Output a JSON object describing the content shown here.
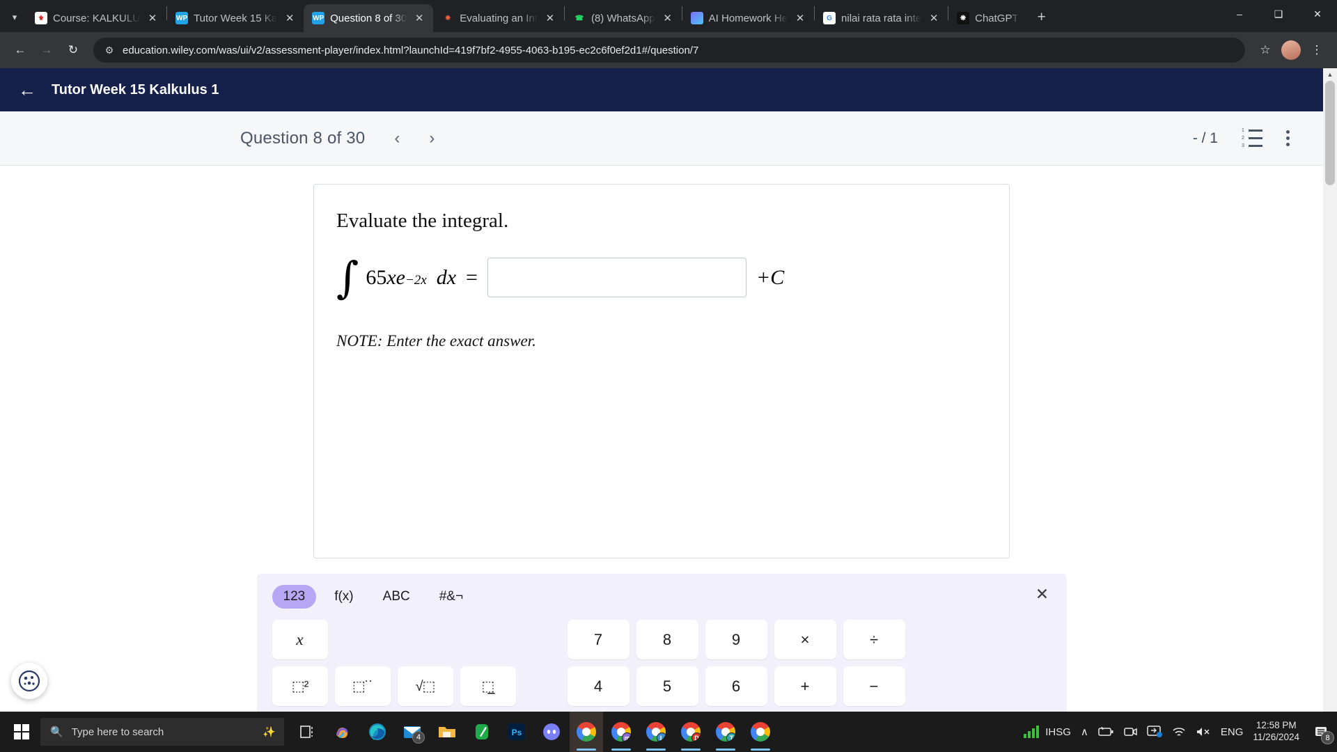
{
  "browser": {
    "tabs": [
      {
        "title": "Course: KALKULU",
        "favicon": "wiley-icon",
        "active": false
      },
      {
        "title": "Tutor Week 15 Ka",
        "favicon": "wileyplus-icon",
        "active": false
      },
      {
        "title": "Question 8 of 30",
        "favicon": "wileyplus-icon",
        "active": true
      },
      {
        "title": "Evaluating an Int",
        "favicon": "symbolab-icon",
        "active": false
      },
      {
        "title": "(8) WhatsApp",
        "favicon": "whatsapp-icon",
        "active": false
      },
      {
        "title": "AI Homework He",
        "favicon": "ai-homework-icon",
        "active": false
      },
      {
        "title": "nilai rata rata inte",
        "favicon": "google-icon",
        "active": false
      },
      {
        "title": "ChatGPT",
        "favicon": "chatgpt-icon",
        "active": false
      }
    ],
    "new_tab_label": "+",
    "window_controls": {
      "minimize": "–",
      "maximize": "❑",
      "close": "✕"
    },
    "toolbar": {
      "back": "←",
      "forward": "→",
      "reload": "↻",
      "site_info_icon": "tune-icon",
      "url": "education.wiley.com/was/ui/v2/assessment-player/index.html?launchId=419f7bf2-4955-4063-b195-ec2c6f0ef2d1#/question/7",
      "bookmark": "☆",
      "menu": "⋮"
    }
  },
  "app": {
    "back_arrow": "←",
    "title": "Tutor Week 15 Kalkulus 1",
    "header_color": "#16214b"
  },
  "question_bar": {
    "label": "Question 8 of 30",
    "prev": "‹",
    "next": "›",
    "score": "- / 1",
    "list_numbers": [
      "1",
      "2",
      "3"
    ],
    "more_menu": "kebab-icon"
  },
  "question": {
    "prompt": "Evaluate the integral.",
    "integral_symbol": "∫",
    "integrand_coefficient": "65",
    "integrand_var": "xe",
    "exponent": "−2x",
    "differential": "dx",
    "equals": "=",
    "answer_value": "",
    "answer_placeholder": "",
    "plus_c": "+C",
    "note": "NOTE: Enter the exact answer."
  },
  "math_keyboard": {
    "tabs": [
      {
        "label": "123",
        "active": true
      },
      {
        "label": "f(x)",
        "active": false
      },
      {
        "label": "ABC",
        "active": false
      },
      {
        "label": "#&¬",
        "active": false
      }
    ],
    "close": "✕",
    "accent_color": "#b7a6f3",
    "left_keys": [
      {
        "label": "x",
        "name": "key-variable-x",
        "style": "var"
      },
      {
        "label": "",
        "name": "key-blank-1",
        "style": "blank"
      },
      {
        "label": "",
        "name": "key-blank-2",
        "style": "blank"
      },
      {
        "label": "",
        "name": "key-blank-3",
        "style": "blank"
      },
      {
        "label": "⬚²",
        "name": "key-square",
        "style": "glyph"
      },
      {
        "label": "⬚˙˙",
        "name": "key-power",
        "style": "glyph"
      },
      {
        "label": "√⬚",
        "name": "key-sqrt",
        "style": "glyph"
      },
      {
        "label": "⬚̲",
        "name": "key-fraction",
        "style": "glyph"
      }
    ],
    "right_keys": [
      {
        "label": "7",
        "name": "key-7"
      },
      {
        "label": "8",
        "name": "key-8"
      },
      {
        "label": "9",
        "name": "key-9"
      },
      {
        "label": "×",
        "name": "key-multiply"
      },
      {
        "label": "÷",
        "name": "key-divide"
      },
      {
        "label": "4",
        "name": "key-4"
      },
      {
        "label": "5",
        "name": "key-5"
      },
      {
        "label": "6",
        "name": "key-6"
      },
      {
        "label": "+",
        "name": "key-plus"
      },
      {
        "label": "−",
        "name": "key-minus"
      }
    ]
  },
  "taskbar": {
    "search_placeholder": "Type here to search",
    "apps": [
      {
        "name": "task-view",
        "glyph": "⧉"
      },
      {
        "name": "copilot",
        "glyph": ""
      },
      {
        "name": "microsoft-edge",
        "glyph": ""
      },
      {
        "name": "mail",
        "glyph": "",
        "badge": "4"
      },
      {
        "name": "file-explorer",
        "glyph": ""
      },
      {
        "name": "onenote",
        "glyph": ""
      },
      {
        "name": "photoshop",
        "glyph": "Ps"
      },
      {
        "name": "discord",
        "glyph": ""
      },
      {
        "name": "chrome-profile-main",
        "glyph": "",
        "letter": ""
      },
      {
        "name": "chrome-profile-m",
        "glyph": "",
        "letter": "m"
      },
      {
        "name": "chrome-profile-l",
        "glyph": "",
        "letter": "L"
      },
      {
        "name": "chrome-profile-d",
        "glyph": "",
        "letter": "D"
      },
      {
        "name": "chrome-profile-t",
        "glyph": "",
        "letter": "T"
      },
      {
        "name": "chrome-profile-extra",
        "glyph": "",
        "letter": ""
      }
    ],
    "tray": {
      "stock_label": "IHSG",
      "show_hidden": "∧",
      "battery": "battery-icon",
      "camera": "camera-icon",
      "display": "display-icon",
      "wifi": "wifi-icon",
      "volume": "volume-mute-icon",
      "language": "ENG",
      "time": "12:58 PM",
      "date": "11/26/2024",
      "notifications_count": "8"
    }
  }
}
